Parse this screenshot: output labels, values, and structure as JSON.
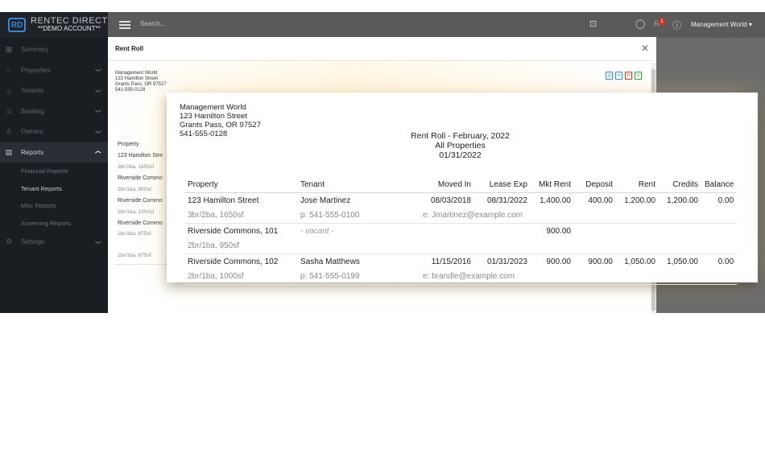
{
  "brand": {
    "name": "RENTEC DIRECT",
    "subtitle": "**DEMO ACCOUNT**",
    "mark": "RD"
  },
  "sidebar": {
    "items": [
      {
        "label": "Summary",
        "icon": "dashboard-icon",
        "glyph": "▦",
        "chevron": ""
      },
      {
        "label": "Properties",
        "icon": "home-icon",
        "glyph": "⌂",
        "chevron": "❯"
      },
      {
        "label": "Tenants",
        "icon": "users-icon",
        "glyph": "☺",
        "chevron": "❯"
      },
      {
        "label": "Banking",
        "icon": "bank-icon",
        "glyph": "⌸",
        "chevron": "❯"
      },
      {
        "label": "Owners",
        "icon": "user-icon",
        "glyph": "♙",
        "chevron": "❯"
      },
      {
        "label": "Reports",
        "icon": "document-icon",
        "glyph": "▤",
        "chevron": "❮"
      }
    ],
    "report_subitems": [
      "Financial Reports",
      "Tenant Reports",
      "Misc Reports",
      "Screening Reports"
    ],
    "settings": {
      "label": "Settings",
      "icon": "gear-icon",
      "glyph": "⚙",
      "chevron": "❯"
    }
  },
  "topbar": {
    "search_placeholder": "Search...",
    "notification_count": "1",
    "user": "Management World ▾"
  },
  "modal": {
    "title": "Rent Roll",
    "close": "✕"
  },
  "company": {
    "name": "Management World",
    "street": "123 Hamilton Street",
    "city": "Grants Pass, OR 97527",
    "phone": "541-555-0128"
  },
  "background_list": {
    "header": "Property",
    "rows": [
      {
        "name": "123 Hamilton Stre",
        "detail": "3br/2ba, 1650sf"
      },
      {
        "name": "Riverside Commo",
        "detail": "2br/1ba, 950sf"
      },
      {
        "name": "Riverside Commo",
        "detail": "2br/1ba, 1000sf"
      },
      {
        "name": "Riverside Commo",
        "detail": "1br/1ba, 875sf"
      },
      {
        "name": "",
        "detail": "1br/1ba, 875sf"
      }
    ]
  },
  "report": {
    "title": "Rent Roll - February, 2022",
    "scope": "All Properties",
    "date": "01/31/2022",
    "columns": [
      "Property",
      "Tenant",
      "Moved In",
      "Lease Exp",
      "Mkt Rent",
      "Deposit",
      "Rent",
      "Credits",
      "Balance"
    ],
    "rows": [
      {
        "property": "123 Hamilton Street",
        "tenant": "Jose Martinez",
        "moved_in": "08/03/2018",
        "lease_exp": "08/31/2022",
        "mkt_rent": "1,400.00",
        "deposit": "400.00",
        "rent": "1,200.00",
        "credits": "1,200.00",
        "balance": "0.00",
        "details": "3br/2ba, 1650sf",
        "phone": "p: 541-555-0100",
        "email": "e: Jmartinez@example.com"
      },
      {
        "property": "Riverside Commons, 101",
        "tenant": "- vacant -",
        "moved_in": "",
        "lease_exp": "",
        "mkt_rent": "900.00",
        "deposit": "",
        "rent": "",
        "credits": "",
        "balance": "",
        "details": "2br/1ba, 950sf",
        "phone": "",
        "email": ""
      },
      {
        "property": "Riverside Commons, 102",
        "tenant": "Sasha Matthews",
        "moved_in": "11/15/2016",
        "lease_exp": "01/31/2023",
        "mkt_rent": "900.00",
        "deposit": "900.00",
        "rent": "1,050.00",
        "credits": "1,050.00",
        "balance": "0.00",
        "details": "2br/1ba, 1000sf",
        "phone": "p: 541-555-0199",
        "email": "e: brandle@example.com"
      }
    ]
  }
}
